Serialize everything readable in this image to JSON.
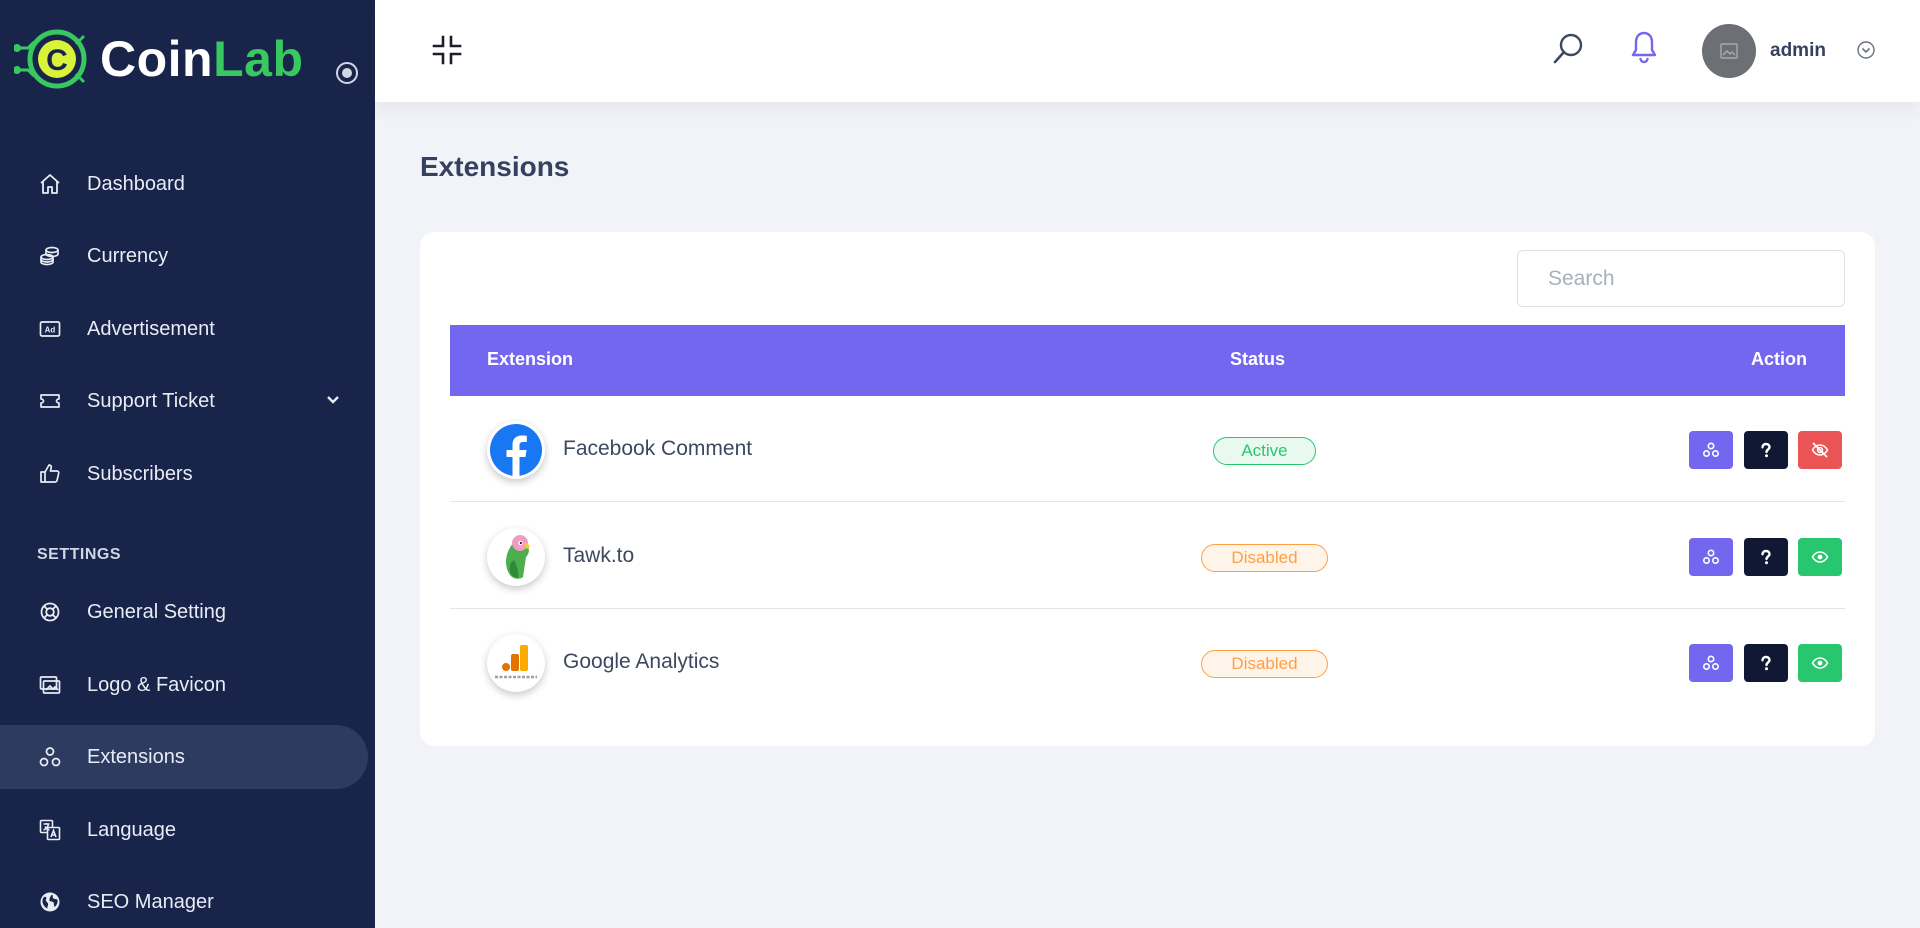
{
  "brand": {
    "name_part1": "Coin",
    "name_part2": "Lab"
  },
  "sidebar": {
    "items": [
      {
        "label": "Dashboard",
        "icon": "home-icon"
      },
      {
        "label": "Currency",
        "icon": "coins-icon"
      },
      {
        "label": "Advertisement",
        "icon": "ad-icon"
      },
      {
        "label": "Support Ticket",
        "icon": "ticket-icon"
      },
      {
        "label": "Subscribers",
        "icon": "thumbs-up-icon"
      }
    ],
    "settings_title": "SETTINGS",
    "settings_items": [
      {
        "label": "General Setting",
        "icon": "life-ring-icon"
      },
      {
        "label": "Logo & Favicon",
        "icon": "images-icon"
      },
      {
        "label": "Extensions",
        "icon": "extensions-icon",
        "active": true
      },
      {
        "label": "Language",
        "icon": "language-icon"
      },
      {
        "label": "SEO Manager",
        "icon": "globe-icon"
      }
    ]
  },
  "topbar": {
    "user_name": "admin"
  },
  "page": {
    "title": "Extensions"
  },
  "search": {
    "placeholder": "Search"
  },
  "table": {
    "headers": {
      "extension": "Extension",
      "status": "Status",
      "action": "Action"
    },
    "rows": [
      {
        "name": "Facebook Comment",
        "status": "Active",
        "logo": "facebook-logo"
      },
      {
        "name": "Tawk.to",
        "status": "Disabled",
        "logo": "tawkto-parrot-logo"
      },
      {
        "name": "Google Analytics",
        "status": "Disabled",
        "logo": "google-analytics-logo"
      }
    ]
  },
  "colors": {
    "sidebar_bg": "#182449",
    "primary": "#7367ef",
    "success": "#28c76f",
    "warning": "#ff9f43",
    "danger": "#ea5455",
    "dark": "#111833"
  }
}
